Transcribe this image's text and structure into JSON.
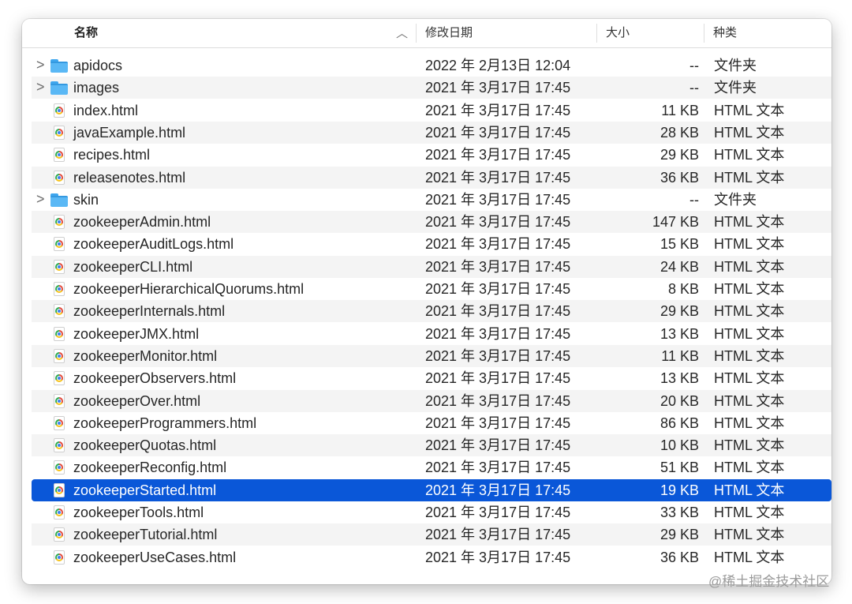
{
  "header": {
    "name": "名称",
    "sort_indicator": "︿",
    "date": "修改日期",
    "size": "大小",
    "kind": "种类"
  },
  "rows": [
    {
      "name": "apidocs",
      "date": "2022 年 2月13日 12:04",
      "size": "--",
      "kind": "文件夹",
      "type": "folder",
      "expandable": true
    },
    {
      "name": "images",
      "date": "2021 年 3月17日 17:45",
      "size": "--",
      "kind": "文件夹",
      "type": "folder",
      "expandable": true
    },
    {
      "name": "index.html",
      "date": "2021 年 3月17日 17:45",
      "size": "11 KB",
      "kind": "HTML 文本",
      "type": "html"
    },
    {
      "name": "javaExample.html",
      "date": "2021 年 3月17日 17:45",
      "size": "28 KB",
      "kind": "HTML 文本",
      "type": "html"
    },
    {
      "name": "recipes.html",
      "date": "2021 年 3月17日 17:45",
      "size": "29 KB",
      "kind": "HTML 文本",
      "type": "html"
    },
    {
      "name": "releasenotes.html",
      "date": "2021 年 3月17日 17:45",
      "size": "36 KB",
      "kind": "HTML 文本",
      "type": "html"
    },
    {
      "name": "skin",
      "date": "2021 年 3月17日 17:45",
      "size": "--",
      "kind": "文件夹",
      "type": "folder",
      "expandable": true
    },
    {
      "name": "zookeeperAdmin.html",
      "date": "2021 年 3月17日 17:45",
      "size": "147 KB",
      "kind": "HTML 文本",
      "type": "html"
    },
    {
      "name": "zookeeperAuditLogs.html",
      "date": "2021 年 3月17日 17:45",
      "size": "15 KB",
      "kind": "HTML 文本",
      "type": "html"
    },
    {
      "name": "zookeeperCLI.html",
      "date": "2021 年 3月17日 17:45",
      "size": "24 KB",
      "kind": "HTML 文本",
      "type": "html"
    },
    {
      "name": "zookeeperHierarchicalQuorums.html",
      "date": "2021 年 3月17日 17:45",
      "size": "8 KB",
      "kind": "HTML 文本",
      "type": "html"
    },
    {
      "name": "zookeeperInternals.html",
      "date": "2021 年 3月17日 17:45",
      "size": "29 KB",
      "kind": "HTML 文本",
      "type": "html"
    },
    {
      "name": "zookeeperJMX.html",
      "date": "2021 年 3月17日 17:45",
      "size": "13 KB",
      "kind": "HTML 文本",
      "type": "html"
    },
    {
      "name": "zookeeperMonitor.html",
      "date": "2021 年 3月17日 17:45",
      "size": "11 KB",
      "kind": "HTML 文本",
      "type": "html"
    },
    {
      "name": "zookeeperObservers.html",
      "date": "2021 年 3月17日 17:45",
      "size": "13 KB",
      "kind": "HTML 文本",
      "type": "html"
    },
    {
      "name": "zookeeperOver.html",
      "date": "2021 年 3月17日 17:45",
      "size": "20 KB",
      "kind": "HTML 文本",
      "type": "html"
    },
    {
      "name": "zookeeperProgrammers.html",
      "date": "2021 年 3月17日 17:45",
      "size": "86 KB",
      "kind": "HTML 文本",
      "type": "html"
    },
    {
      "name": "zookeeperQuotas.html",
      "date": "2021 年 3月17日 17:45",
      "size": "10 KB",
      "kind": "HTML 文本",
      "type": "html"
    },
    {
      "name": "zookeeperReconfig.html",
      "date": "2021 年 3月17日 17:45",
      "size": "51 KB",
      "kind": "HTML 文本",
      "type": "html"
    },
    {
      "name": "zookeeperStarted.html",
      "date": "2021 年 3月17日 17:45",
      "size": "19 KB",
      "kind": "HTML 文本",
      "type": "html",
      "selected": true
    },
    {
      "name": "zookeeperTools.html",
      "date": "2021 年 3月17日 17:45",
      "size": "33 KB",
      "kind": "HTML 文本",
      "type": "html"
    },
    {
      "name": "zookeeperTutorial.html",
      "date": "2021 年 3月17日 17:45",
      "size": "29 KB",
      "kind": "HTML 文本",
      "type": "html"
    },
    {
      "name": "zookeeperUseCases.html",
      "date": "2021 年 3月17日 17:45",
      "size": "36 KB",
      "kind": "HTML 文本",
      "type": "html"
    }
  ],
  "chevron_glyph": ">",
  "selection_color": "#0a57d8",
  "watermark": "@稀土掘金技术社区"
}
